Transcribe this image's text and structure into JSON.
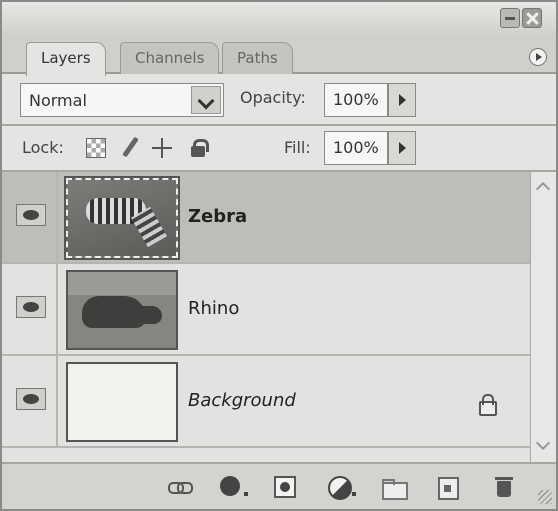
{
  "tabs": [
    {
      "label": "Layers",
      "active": true
    },
    {
      "label": "Channels",
      "active": false
    },
    {
      "label": "Paths",
      "active": false
    }
  ],
  "blend_mode": {
    "selected": "Normal"
  },
  "opacity": {
    "label": "Opacity:",
    "value": "100%"
  },
  "lock": {
    "label": "Lock:"
  },
  "fill": {
    "label": "Fill:",
    "value": "100%"
  },
  "layers": [
    {
      "name": "Zebra",
      "selected": true,
      "visible": true,
      "locked": false
    },
    {
      "name": "Rhino",
      "selected": false,
      "visible": true,
      "locked": false
    },
    {
      "name": "Background",
      "selected": false,
      "visible": true,
      "locked": true
    }
  ],
  "icons": {
    "lock_transparency": "checkerboard-icon",
    "lock_image": "brush-icon",
    "lock_position": "move-icon",
    "lock_all": "padlock-icon",
    "toolbar": [
      "link-icon",
      "layer-style-icon",
      "layer-mask-icon",
      "adjustment-layer-icon",
      "group-folder-icon",
      "new-layer-icon",
      "trash-icon"
    ]
  }
}
